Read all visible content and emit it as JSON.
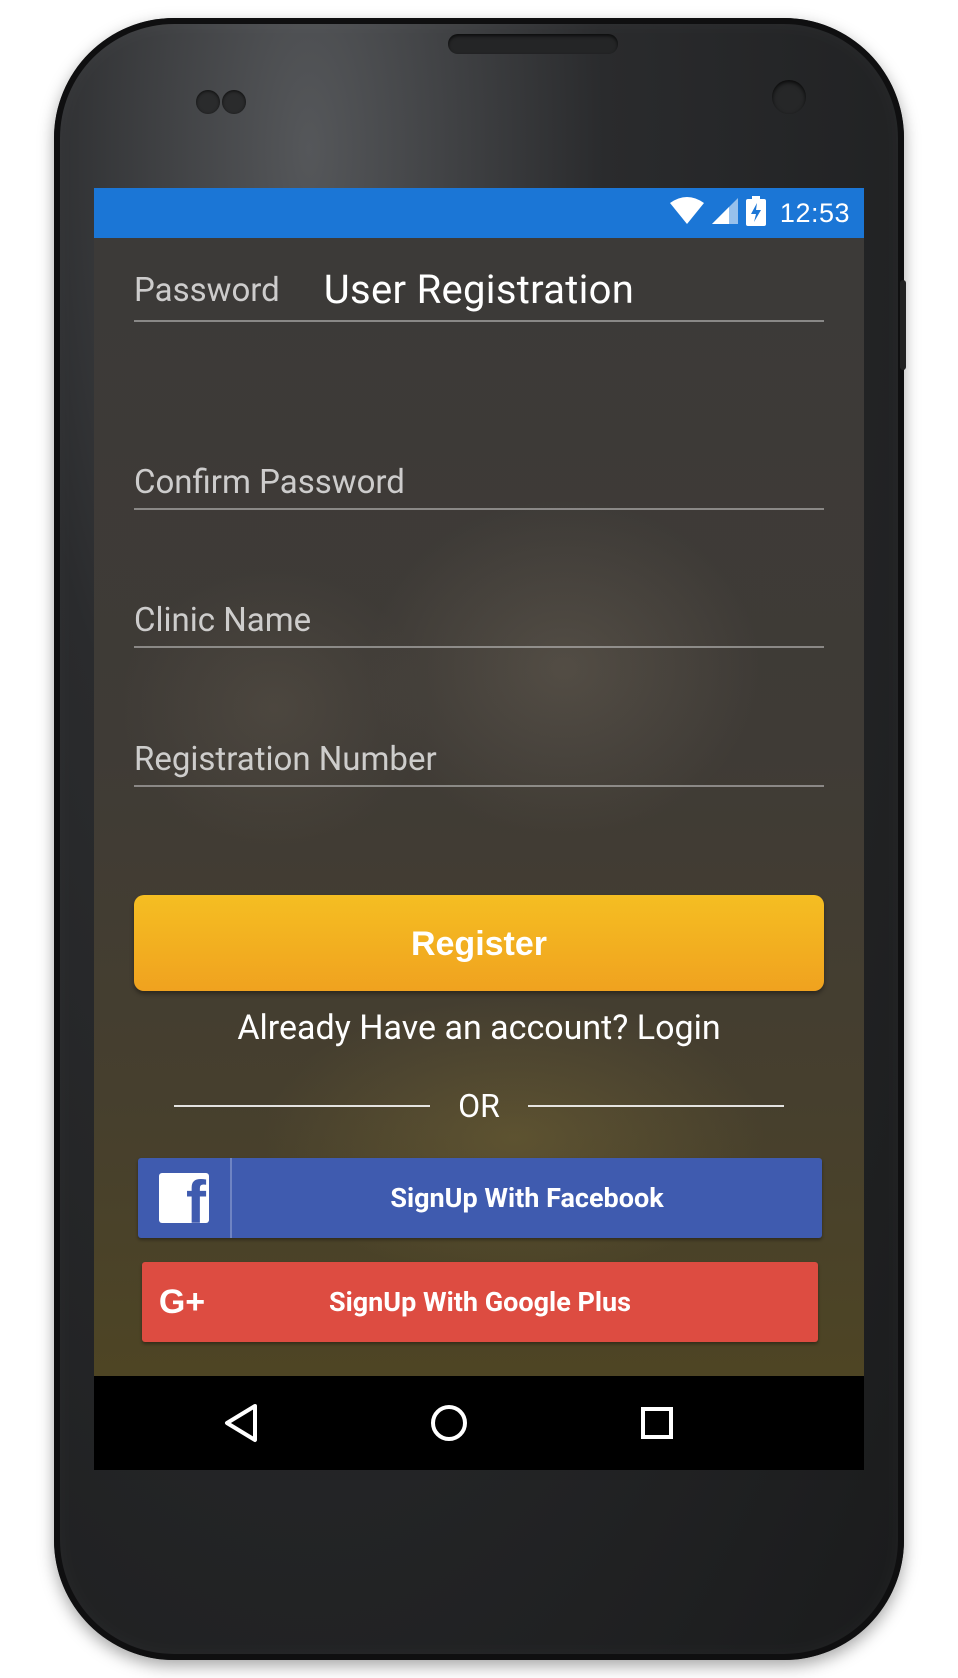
{
  "status_bar": {
    "time": "12:53",
    "icons": [
      "wifi-icon",
      "cell-signal-icon",
      "battery-charging-icon"
    ],
    "color": "#1b76d6"
  },
  "header": {
    "title": "User Registration"
  },
  "form": {
    "fields": [
      {
        "name": "password",
        "placeholder": "Password",
        "value": ""
      },
      {
        "name": "confirm_password",
        "placeholder": "Confirm Password",
        "value": ""
      },
      {
        "name": "clinic_name",
        "placeholder": "Clinic Name",
        "value": ""
      },
      {
        "name": "registration_number",
        "placeholder": "Registration Number",
        "value": ""
      }
    ],
    "register_label": "Register",
    "register_color": "#f3ae20"
  },
  "login_prompt": "Already Have an account? Login",
  "divider_text": "OR",
  "social": {
    "facebook": {
      "label": "SignUp With Facebook",
      "icon": "facebook-icon",
      "color": "#3f5baf"
    },
    "google": {
      "label": "SignUp With Google Plus",
      "icon": "google-plus-icon",
      "icon_text": "G+",
      "color": "#dd4c41"
    }
  },
  "nav_bar": {
    "buttons": [
      "back-icon",
      "home-icon",
      "recents-icon"
    ]
  }
}
